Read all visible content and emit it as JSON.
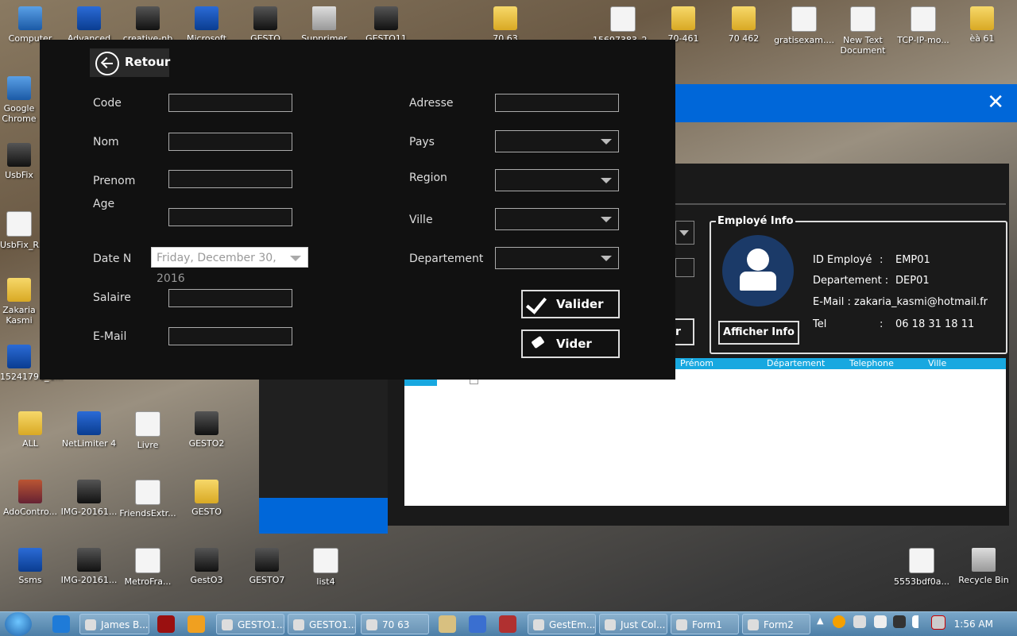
{
  "desktop": {
    "icons": [
      {
        "label": "Computer",
        "icon": "computer-icon"
      },
      {
        "label": "Advanced",
        "icon": "app-icon"
      },
      {
        "label": "creative-nb",
        "icon": "app-icon"
      },
      {
        "label": "Microsoft",
        "icon": "app-icon"
      },
      {
        "label": "GESTO",
        "icon": "app-icon"
      },
      {
        "label": "Supprimer",
        "icon": "recycle-icon"
      },
      {
        "label": "GESTO11",
        "icon": "app-icon"
      },
      {
        "label": "70 63",
        "icon": "folder-icon"
      },
      {
        "label": "15697383_2...",
        "icon": "image-icon"
      },
      {
        "label": "70-461",
        "icon": "folder-icon"
      },
      {
        "label": "70 462",
        "icon": "folder-icon"
      },
      {
        "label": "gratisexam....",
        "icon": "document-icon"
      },
      {
        "label": "New Text Document",
        "icon": "document-icon"
      },
      {
        "label": "TCP-IP-mo...",
        "icon": "document-icon"
      },
      {
        "label": "èà 61",
        "icon": "folder-icon"
      },
      {
        "label": "Google Chrome",
        "icon": "chrome-icon"
      },
      {
        "label": "UsbFix",
        "icon": "app-icon"
      },
      {
        "label": "UsbFix_R...",
        "icon": "document-icon"
      },
      {
        "label": "Zakaria Kasmi",
        "icon": "folder-icon"
      },
      {
        "label": "15241791_1...",
        "icon": "document-icon"
      },
      {
        "label": "ALL",
        "icon": "folder-icon"
      },
      {
        "label": "NetLimiter 4",
        "icon": "app-icon"
      },
      {
        "label": "Livre",
        "icon": "document-icon"
      },
      {
        "label": "GESTO2",
        "icon": "app-icon"
      },
      {
        "label": "AdoContro...",
        "icon": "archive-icon"
      },
      {
        "label": "IMG-20161...",
        "icon": "image-icon"
      },
      {
        "label": "FriendsExtr...",
        "icon": "document-icon"
      },
      {
        "label": "GESTO",
        "icon": "folder-icon"
      },
      {
        "label": "Ssms",
        "icon": "app-icon"
      },
      {
        "label": "IMG-20161...",
        "icon": "image-icon"
      },
      {
        "label": "MetroFra...",
        "icon": "document-icon"
      },
      {
        "label": "GestO3",
        "icon": "app-icon"
      },
      {
        "label": "GESTO7",
        "icon": "app-icon"
      },
      {
        "label": "list4",
        "icon": "document-icon"
      },
      {
        "label": "5553bdf0a...",
        "icon": "image-icon"
      },
      {
        "label": "Recycle Bin",
        "icon": "recycle-icon"
      }
    ]
  },
  "form1": {
    "close_glyph": "✕",
    "fragment_button": "r",
    "info_title": "Employé Info",
    "afficher_label": "Afficher Info",
    "fields": [
      {
        "label": "ID Employé",
        "colon": ":",
        "value": "EMP01"
      },
      {
        "label": "Departement :",
        "colon": "",
        "value": "DEP01"
      },
      {
        "label": "E-Mail :",
        "colon": "",
        "value": "zakaria_kasmi@hotmail.fr"
      },
      {
        "label": "Tel",
        "colon": ":",
        "value": "06 18 31 18 11"
      }
    ],
    "grid_columns": [
      "Prénom",
      "Département",
      "Telephone",
      "Ville"
    ]
  },
  "form2": {
    "retour_label": "Retour",
    "labels": {
      "code": "Code",
      "nom": "Nom",
      "prenom": "Prenom",
      "age": "Age",
      "date": "Date N",
      "salaire": "Salaire",
      "email": "E-Mail",
      "adresse": "Adresse",
      "pays": "Pays",
      "region": "Region",
      "ville": "Ville",
      "departement": "Departement"
    },
    "date_value": "Friday, December 30, 2016",
    "valider_label": "Valider",
    "vider_label": "Vider"
  },
  "taskbar": {
    "buttons": [
      "James B...",
      "GESTO1...",
      "GESTO1...",
      "70 63",
      "GestEm...",
      "Just Col...",
      "Form1",
      "Form2"
    ],
    "clock": "1:56 AM"
  }
}
